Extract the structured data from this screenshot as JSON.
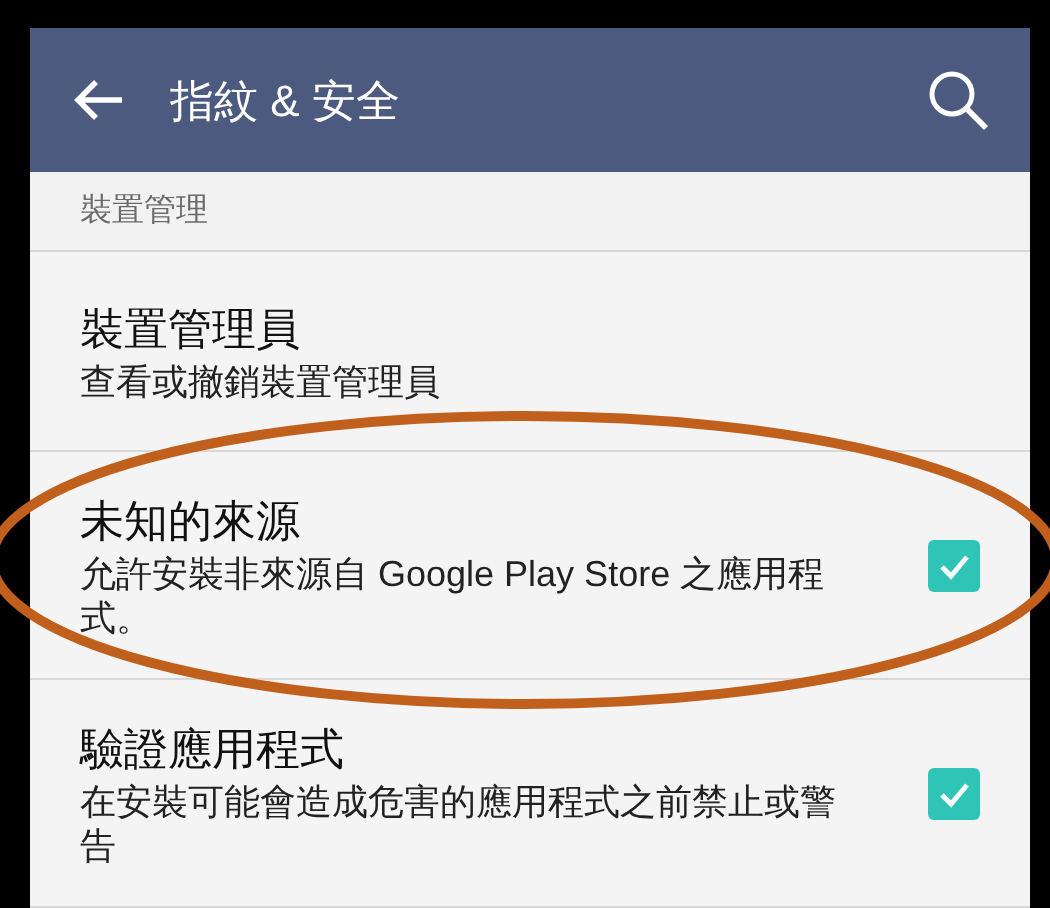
{
  "app_bar": {
    "title": "指紋 & 安全"
  },
  "section": {
    "title": "裝置管理"
  },
  "items": [
    {
      "kind": "plain",
      "title": "裝置管理員",
      "summary": "查看或撤銷裝置管理員"
    },
    {
      "kind": "checkbox",
      "title": "未知的來源",
      "summary": "允許安裝非來源自 Google Play Store 之應用程式。",
      "checked": true
    },
    {
      "kind": "checkbox",
      "title": "驗證應用程式",
      "summary": "在安裝可能會造成危害的應用程式之前禁止或警告",
      "checked": true
    }
  ]
}
